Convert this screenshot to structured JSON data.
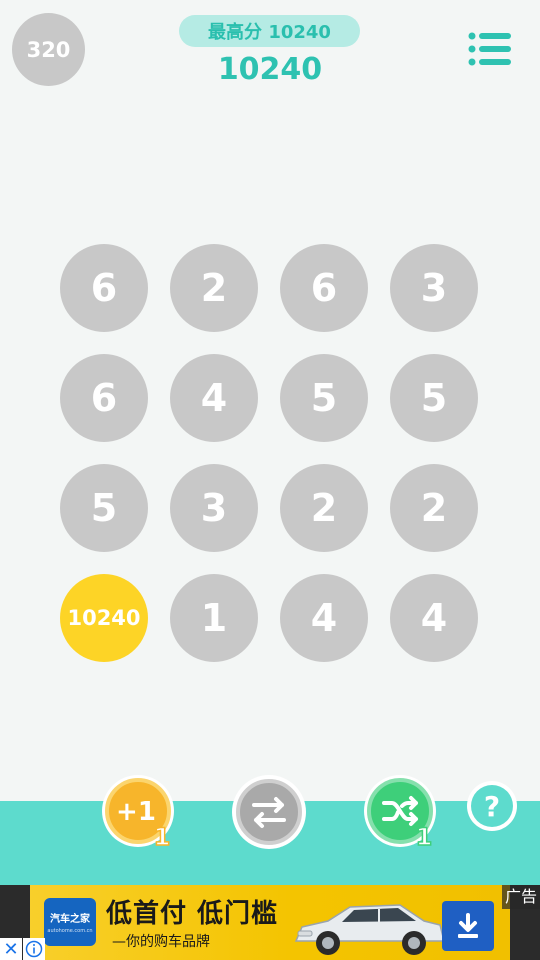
{
  "header": {
    "level": "320",
    "best_score_label": "最高分 10240",
    "current_score": "10240",
    "menu_icon": "list-menu-icon"
  },
  "board": {
    "rows": [
      [
        "6",
        "2",
        "6",
        "3"
      ],
      [
        "6",
        "4",
        "5",
        "5"
      ],
      [
        "5",
        "3",
        "2",
        "2"
      ],
      [
        "10240",
        "1",
        "4",
        "4"
      ]
    ],
    "highlight_tile": "10240"
  },
  "powerups": {
    "plus_one": {
      "label": "+1",
      "count": "1",
      "icon": "plus-one-icon"
    },
    "swap": {
      "icon": "swap-arrows-icon"
    },
    "shuffle": {
      "count": "1",
      "icon": "shuffle-icon"
    },
    "help": {
      "label": "?",
      "icon": "help-icon"
    }
  },
  "ad": {
    "logo_text": "汽车之家",
    "logo_url_text": "autohome.com.cn",
    "headline": "低首付 低门槛",
    "subline": "—你的购车品牌",
    "tag": "广告",
    "close": "✕",
    "download_icon": "download-icon",
    "info_icon": "info-icon"
  },
  "colors": {
    "background": "#f3f6f5",
    "tile_gray": "#c8c8c8",
    "tile_gold": "#fdd426",
    "accent_teal": "#2ec2b1",
    "bottom_bar": "#5ddbcd",
    "plus_orange": "#f7b52b",
    "shuffle_green": "#3ecf7a",
    "swap_gray": "#a9a9a9"
  }
}
